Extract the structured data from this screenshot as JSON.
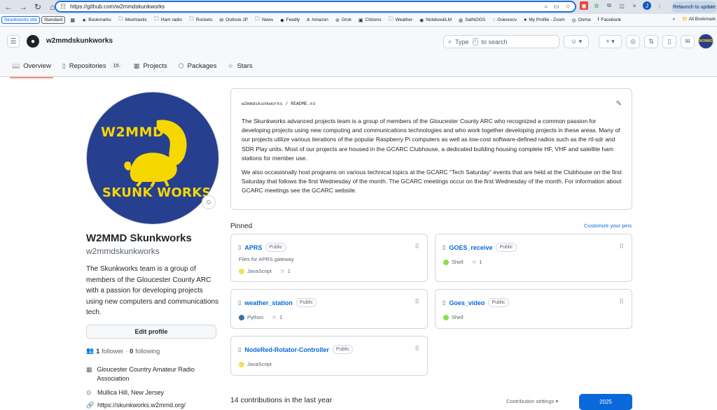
{
  "browser": {
    "url": "https://github.com/w2mmdskunkworks",
    "relaunch_label": "Relaunch to update",
    "profile_initial": "J",
    "bookmarks": [
      {
        "label": "Bookmarks",
        "icon": "star-icon"
      },
      {
        "label": "Meshtastic",
        "icon": "folder-icon"
      },
      {
        "label": "Ham radio",
        "icon": "folder-icon"
      },
      {
        "label": "Rockets",
        "icon": "folder-icon"
      },
      {
        "label": "Outlook JP",
        "icon": "outlook-icon"
      },
      {
        "label": "News",
        "icon": "folder-icon"
      },
      {
        "label": "Feedly",
        "icon": "feedly-icon"
      },
      {
        "label": "Amazon",
        "icon": "amazon-icon"
      },
      {
        "label": "Grok",
        "icon": "grok-icon"
      },
      {
        "label": "Citizens",
        "icon": "citizens-icon"
      },
      {
        "label": "Weather",
        "icon": "folder-icon"
      },
      {
        "label": "NotebookLM",
        "icon": "notebooklm-icon"
      },
      {
        "label": "SatNOGS",
        "icon": "satnogs-icon"
      },
      {
        "label": "Goesrecv",
        "icon": "goesrecv-icon"
      },
      {
        "label": "My Profile - Zoom",
        "icon": "zoom-icon"
      },
      {
        "label": "Ooma",
        "icon": "ooma-icon"
      },
      {
        "label": "Facebook",
        "icon": "facebook-icon"
      }
    ],
    "chips": [
      "Skunkworks site",
      "Standard"
    ],
    "all_bookmarks": "All Bookmark"
  },
  "header": {
    "username": "w2mmdskunkworks",
    "search_type": "Type",
    "search_key": "/",
    "search_suffix": "to search"
  },
  "tabs": [
    {
      "label": "Overview",
      "icon": "book-icon"
    },
    {
      "label": "Repositories",
      "icon": "repo-icon",
      "count": "15"
    },
    {
      "label": "Projects",
      "icon": "table-icon"
    },
    {
      "label": "Packages",
      "icon": "package-icon"
    },
    {
      "label": "Stars",
      "icon": "star-icon"
    }
  ],
  "profile": {
    "avatar_line1": "W2MMD",
    "avatar_line2": "SKUNK WORKS",
    "name": "W2MMD Skunkworks",
    "login": "w2mmdskunkworks",
    "bio": "The Skunkworks team is a group of members of the Gloucester County ARC with a passion for developing projects using new computers and communications tech.",
    "edit_label": "Edit profile",
    "followers_count": "1",
    "followers_label": "follower",
    "sep": "·",
    "following_count": "0",
    "following_label": "following",
    "org": "Gloucester Country Amateur Radio Association",
    "location": "Mullica Hill, New Jersey",
    "website": "https://skunkworks.w2mmd.org/"
  },
  "readme": {
    "owner": "w2mmdskunkworks",
    "slash": "/",
    "file": "README",
    "ext": ".md",
    "para1": "The Skunkworks advanced projects team is a group of members of the Gloucester County ARC who recognized a common passion for developing projects using new computing and communications technologies and who work together developing projects in these areas. Many of our projects utilize various iterations of the popular Raspberry Pi computers as well as low-cost software-defined radios such as the rtl-sdr and SDR Play units. Most of our projects are housed in the GCARC Clubhouse, a dedicated building housing complete HF, VHF and satellite ham stations for member use.",
    "para2": "We also occasionally host programs on various technical topics at the GCARC “Tech Saturday” events that are held at the Clubhouse on the first Saturday that follows the first Wednesday of the month. The GCARC meetings occur on the first Wednesday of the month. For information about GCARC meetings see the GCARC website."
  },
  "pinned": {
    "title": "Pinned",
    "customize": "Customize your pins",
    "repos": [
      {
        "name": "APRS",
        "vis": "Public",
        "desc": "Files for APRS gateway",
        "lang": "JavaScript",
        "lang_color": "#f1e05a",
        "stars": "1"
      },
      {
        "name": "GOES_receive",
        "vis": "Public",
        "desc": "",
        "lang": "Shell",
        "lang_color": "#89e051",
        "stars": "1"
      },
      {
        "name": "weather_station",
        "vis": "Public",
        "desc": "",
        "lang": "Python",
        "lang_color": "#3572A5",
        "stars": "1"
      },
      {
        "name": "Goes_video",
        "vis": "Public",
        "desc": "",
        "lang": "Shell",
        "lang_color": "#89e051",
        "stars": ""
      },
      {
        "name": "NodeRed-Rotator-Controller",
        "vis": "Public",
        "desc": "",
        "lang": "JavaScript",
        "lang_color": "#f1e05a",
        "stars": ""
      }
    ]
  },
  "contributions": {
    "title": "14 contributions in the last year",
    "settings": "Contribution settings",
    "year": "2025"
  }
}
